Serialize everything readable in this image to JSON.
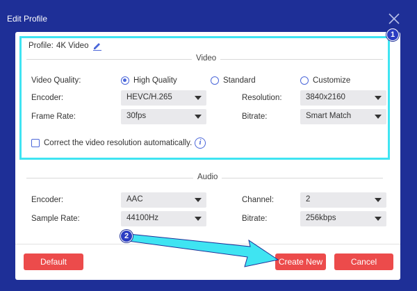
{
  "window": {
    "title": "Edit Profile",
    "close_icon": "close-icon"
  },
  "profile": {
    "label": "Profile:",
    "value": "4K Video",
    "edit_icon": "pencil-icon"
  },
  "video": {
    "section_title": "Video",
    "quality_label": "Video Quality:",
    "quality_options": [
      "High Quality",
      "Standard",
      "Customize"
    ],
    "quality_selected": "High Quality",
    "encoder_label": "Encoder:",
    "encoder_value": "HEVC/H.265",
    "resolution_label": "Resolution:",
    "resolution_value": "3840x2160",
    "frame_rate_label": "Frame Rate:",
    "frame_rate_value": "30fps",
    "bitrate_label": "Bitrate:",
    "bitrate_value": "Smart Match",
    "auto_correct_label": "Correct the video resolution automatically.",
    "auto_correct_checked": false
  },
  "audio": {
    "section_title": "Audio",
    "encoder_label": "Encoder:",
    "encoder_value": "AAC",
    "channel_label": "Channel:",
    "channel_value": "2",
    "sample_rate_label": "Sample Rate:",
    "sample_rate_value": "44100Hz",
    "bitrate_label": "Bitrate:",
    "bitrate_value": "256kbps"
  },
  "buttons": {
    "default": "Default",
    "create_new": "Create New",
    "cancel": "Cancel"
  },
  "annotations": {
    "badge_1": "1",
    "badge_2": "2",
    "highlight_color": "#3fe4f2",
    "arrow_color": "#3fe4f2"
  },
  "colors": {
    "frame": "#1e2f97",
    "button": "#ec4b4b",
    "accent": "#4a66d9",
    "select_bg": "#e9e9ec"
  }
}
